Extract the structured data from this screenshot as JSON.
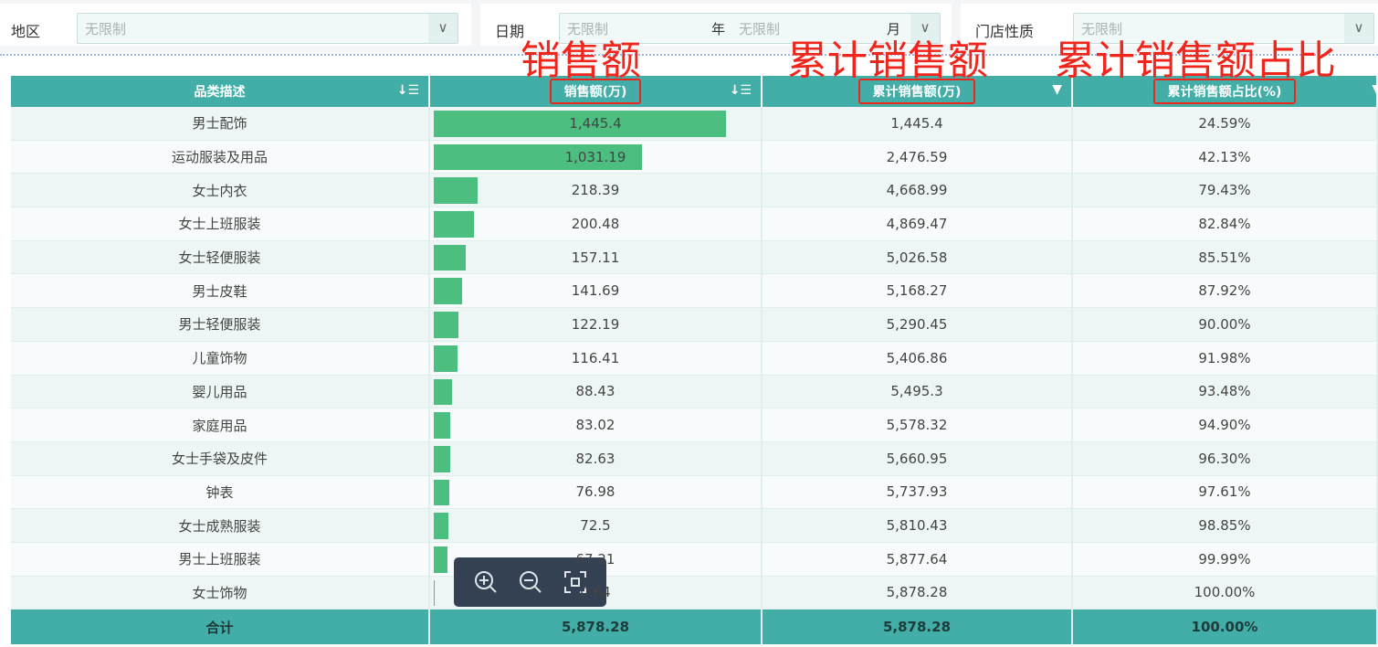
{
  "filters": {
    "region": {
      "label": "地区",
      "placeholder": "无限制"
    },
    "date": {
      "label": "日期",
      "year_placeholder": "无限制",
      "year_label": "年",
      "month_placeholder": "无限制",
      "month_label": "月"
    },
    "store": {
      "label": "门店性质",
      "placeholder": "无限制"
    }
  },
  "annotations": [
    "销售额",
    "累计销售额",
    "累计销售额占比"
  ],
  "table": {
    "headers": [
      "品类描述",
      "销售额(万)",
      "累计销售额(万)",
      "累计销售额占比(%)"
    ],
    "rows": [
      {
        "category": "男士配饰",
        "sales": "1,445.4",
        "sales_value": 1445.4,
        "cum": "1,445.4",
        "pct": "24.59%"
      },
      {
        "category": "运动服装及用品",
        "sales": "1,031.19",
        "sales_value": 1031.19,
        "cum": "2,476.59",
        "pct": "42.13%"
      },
      {
        "category": "女士内衣",
        "sales": "218.39",
        "sales_value": 218.39,
        "cum": "4,668.99",
        "pct": "79.43%"
      },
      {
        "category": "女士上班服装",
        "sales": "200.48",
        "sales_value": 200.48,
        "cum": "4,869.47",
        "pct": "82.84%"
      },
      {
        "category": "女士轻便服装",
        "sales": "157.11",
        "sales_value": 157.11,
        "cum": "5,026.58",
        "pct": "85.51%"
      },
      {
        "category": "男士皮鞋",
        "sales": "141.69",
        "sales_value": 141.69,
        "cum": "5,168.27",
        "pct": "87.92%"
      },
      {
        "category": "男士轻便服装",
        "sales": "122.19",
        "sales_value": 122.19,
        "cum": "5,290.45",
        "pct": "90.00%"
      },
      {
        "category": "儿童饰物",
        "sales": "116.41",
        "sales_value": 116.41,
        "cum": "5,406.86",
        "pct": "91.98%"
      },
      {
        "category": "婴儿用品",
        "sales": "88.43",
        "sales_value": 88.43,
        "cum": "5,495.3",
        "pct": "93.48%"
      },
      {
        "category": "家庭用品",
        "sales": "83.02",
        "sales_value": 83.02,
        "cum": "5,578.32",
        "pct": "94.90%"
      },
      {
        "category": "女士手袋及皮件",
        "sales": "82.63",
        "sales_value": 82.63,
        "cum": "5,660.95",
        "pct": "96.30%"
      },
      {
        "category": "钟表",
        "sales": "76.98",
        "sales_value": 76.98,
        "cum": "5,737.93",
        "pct": "97.61%"
      },
      {
        "category": "女士成熟服装",
        "sales": "72.5",
        "sales_value": 72.5,
        "cum": "5,810.43",
        "pct": "98.85%"
      },
      {
        "category": "男士上班服装",
        "sales": "67.21",
        "sales_value": 67.21,
        "cum": "5,877.64",
        "pct": "99.99%"
      },
      {
        "category": "女士饰物",
        "sales": "0.64",
        "sales_value": 0.64,
        "cum": "5,878.28",
        "pct": "100.00%"
      }
    ],
    "total": {
      "label": "合计",
      "sales": "5,878.28",
      "cum": "5,878.28",
      "pct": "100.00%"
    },
    "bar_color": "#4cbf80",
    "header_color": "#42aea7"
  },
  "zoom_toolbar": [
    "zoom-in",
    "zoom-out",
    "fit-screen"
  ]
}
